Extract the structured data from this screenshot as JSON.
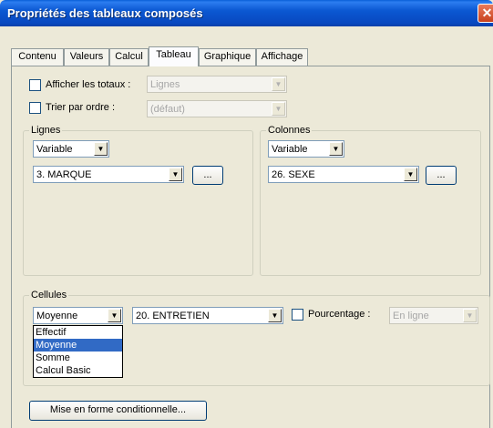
{
  "window": {
    "title": "Propriétés des tableaux composés"
  },
  "tabs": [
    {
      "label": "Contenu",
      "active": false
    },
    {
      "label": "Valeurs",
      "active": false
    },
    {
      "label": "Calcul",
      "active": false
    },
    {
      "label": "Tableau",
      "active": true
    },
    {
      "label": "Graphique",
      "active": false
    },
    {
      "label": "Affichage",
      "active": false
    }
  ],
  "options": {
    "totals": {
      "label": "Afficher les totaux :",
      "checked": false,
      "value": "Lignes"
    },
    "sort": {
      "label": "Trier par ordre :",
      "checked": false,
      "value": "(défaut)"
    }
  },
  "lignes": {
    "title": "Lignes",
    "type_value": "Variable",
    "variable_value": "3. MARQUE",
    "browse_label": "..."
  },
  "colonnes": {
    "title": "Colonnes",
    "type_value": "Variable",
    "variable_value": "26. SEXE",
    "browse_label": "..."
  },
  "cellules": {
    "title": "Cellules",
    "stat_value": "Moyenne",
    "stat_options": [
      "Effectif",
      "Moyenne",
      "Somme",
      "Calcul Basic"
    ],
    "selected_index": 1,
    "variable_value": "20. ENTRETIEN",
    "percent_label": "Pourcentage :",
    "percent_checked": false,
    "percent_value": "En ligne"
  },
  "conditional_button": "Mise en forme conditionnelle..."
}
